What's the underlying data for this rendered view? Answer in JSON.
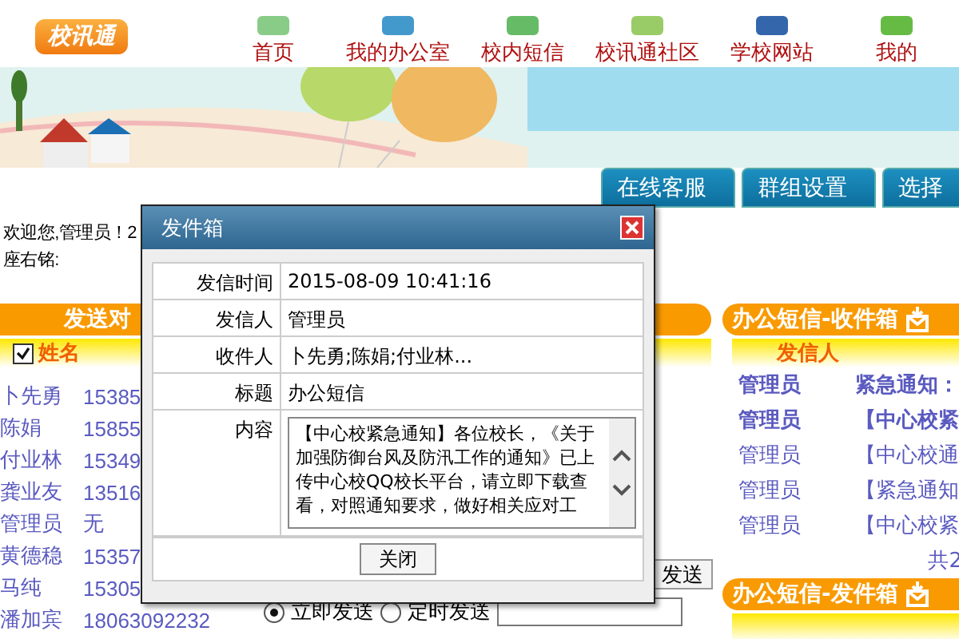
{
  "header": {
    "logo": "校讯通",
    "nav": [
      "首页",
      "我的办公室",
      "校内短信",
      "校讯通社区",
      "学校网站",
      "我的"
    ]
  },
  "tabs": [
    {
      "label": "在线客服",
      "selected": false
    },
    {
      "label": "群组设置",
      "selected": false
    },
    {
      "label": "选择",
      "selected": false
    }
  ],
  "welcome": {
    "greeting": "欢迎您,管理员！2",
    "motto": "座右铭:"
  },
  "recipients": {
    "title": "发送对",
    "header": {
      "checked": true,
      "name": "姓名"
    },
    "rows": [
      {
        "name": "卜先勇",
        "phone": "15385"
      },
      {
        "name": "陈娟",
        "phone": "15855"
      },
      {
        "name": "付业林",
        "phone": "15349"
      },
      {
        "name": "龚业友",
        "phone": "13516"
      },
      {
        "name": "管理员",
        "phone": "无"
      },
      {
        "name": "黄德稳",
        "phone": "15357"
      },
      {
        "name": "马纯",
        "phone": "15305"
      },
      {
        "name": "潘加宾",
        "phone": "18063092232"
      }
    ]
  },
  "send_button": "发送",
  "send_mode": [
    {
      "label": "立即发送",
      "selected": true
    },
    {
      "label": "定时发送",
      "selected": false
    }
  ],
  "inbox": {
    "title": "办公短信-收件箱",
    "column": "发信人",
    "rows": [
      {
        "sender": "管理员",
        "subject": "紧急通知：",
        "unread": true
      },
      {
        "sender": "管理员",
        "subject": "【中心校紧",
        "unread": true
      },
      {
        "sender": "管理员",
        "subject": "【中心校通",
        "unread": false
      },
      {
        "sender": "管理员",
        "subject": "【紧急通知",
        "unread": false
      },
      {
        "sender": "管理员",
        "subject": "【中心校紧",
        "unread": false
      }
    ],
    "total": "共2"
  },
  "outbox": {
    "title": "办公短信-发件箱"
  },
  "dialog": {
    "title": "发件箱",
    "fields": [
      {
        "label": "发信时间",
        "value": "2015-08-09 10:41:16"
      },
      {
        "label": "发信人",
        "value": "管理员"
      },
      {
        "label": "收件人",
        "value": "卜先勇;陈娟;付业林..."
      },
      {
        "label": "标题",
        "value": "办公短信"
      }
    ],
    "content_label": "内容",
    "content": "【中心校紧急通知】各位校长，《关于加强防御台风及防汛工作的通知》已上传中心校QQ校长平台，请立即下载查看，对照通知要求，做好相关应对工",
    "close_button": "关闭"
  }
}
